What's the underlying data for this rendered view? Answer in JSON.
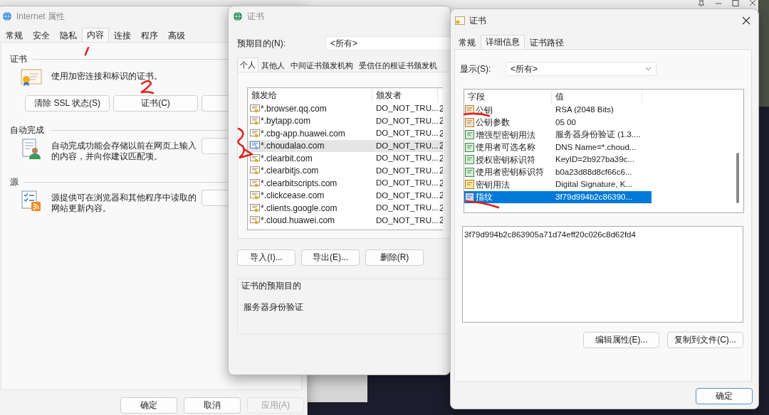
{
  "internet_options": {
    "title": "Internet 属性",
    "tabs": [
      {
        "label": "常规",
        "selected": false
      },
      {
        "label": "安全",
        "selected": false
      },
      {
        "label": "隐私",
        "selected": false
      },
      {
        "label": "内容",
        "selected": true
      },
      {
        "label": "连接",
        "selected": false
      },
      {
        "label": "程序",
        "selected": false
      },
      {
        "label": "高级",
        "selected": false
      }
    ],
    "sections": [
      {
        "kind": "certificates",
        "heading": "证书",
        "description": "使用加密连接和标识的证书。",
        "buttons": [
          "清除 SSL 状态(S)",
          "证书(C)"
        ],
        "covered_button": true
      },
      {
        "kind": "autocomplete",
        "heading": "自动完成",
        "description": "自动完成功能会存储以前在网页上输入的内容，并向你建议匹配项。",
        "covered_button": true
      },
      {
        "kind": "feeds",
        "heading": "源",
        "description": "源提供可在浏览器和其他程序中读取的网站更新内容。",
        "covered_button": true
      }
    ],
    "footer_buttons": [
      {
        "label": "确定",
        "disabled": false
      },
      {
        "label": "取消",
        "disabled": false
      },
      {
        "label": "应用(A)",
        "disabled": true
      }
    ]
  },
  "certificate_manager": {
    "title": "证书",
    "purpose_label": "预期目的(N):",
    "purpose_value": "<所有>",
    "tabs": [
      {
        "label": "个人",
        "selected": true
      },
      {
        "label": "其他人",
        "selected": false
      },
      {
        "label": "中间证书颁发机构",
        "selected": false
      },
      {
        "label": "受信任的根证书颁发机",
        "selected": false
      }
    ],
    "columns": [
      "颁发给",
      "颁发者"
    ],
    "rows": [
      {
        "issued_to": "*.browser.qq.com",
        "issued_by": "DO_NOT_TRU...",
        "column_3": "2",
        "selected": false
      },
      {
        "issued_to": "*.bytapp.com",
        "issued_by": "DO_NOT_TRU...",
        "column_3": "2",
        "selected": false
      },
      {
        "issued_to": "*.cbg-app.huawei.com",
        "issued_by": "DO_NOT_TRU...",
        "column_3": "2",
        "selected": false
      },
      {
        "issued_to": "*.choudalao.com",
        "issued_by": "DO_NOT_TRU...",
        "column_3": "2",
        "selected": true
      },
      {
        "issued_to": "*.clearbit.com",
        "issued_by": "DO_NOT_TRU...",
        "column_3": "2",
        "selected": false
      },
      {
        "issued_to": "*.clearbitjs.com",
        "issued_by": "DO_NOT_TRU...",
        "column_3": "2",
        "selected": false
      },
      {
        "issued_to": "*.clearbitscripts.com",
        "issued_by": "DO_NOT_TRU...",
        "column_3": "2",
        "selected": false
      },
      {
        "issued_to": "*.clickcease.com",
        "issued_by": "DO_NOT_TRU...",
        "column_3": "2",
        "selected": false
      },
      {
        "issued_to": "*.clients.google.com",
        "issued_by": "DO_NOT_TRU...",
        "column_3": "2",
        "selected": false
      },
      {
        "issued_to": "*.cloud.huawei.com",
        "issued_by": "DO_NOT_TRU...",
        "column_3": "2",
        "selected": false
      }
    ],
    "buttons": [
      "导入(I)...",
      "导出(E)...",
      "删除(R)"
    ],
    "purpose_group": {
      "title": "证书的预期目的",
      "text": "服务器身份验证"
    }
  },
  "certificate_viewer": {
    "title": "证书",
    "tabs": [
      {
        "label": "常规",
        "selected": false
      },
      {
        "label": "详细信息",
        "selected": true
      },
      {
        "label": "证书路径",
        "selected": false
      }
    ],
    "show_label": "显示(S):",
    "show_value": "<所有>",
    "columns": [
      "字段",
      "值"
    ],
    "fields": [
      {
        "name": "公钥",
        "value": "RSA (2048 Bits)",
        "kind": "property",
        "selected": false
      },
      {
        "name": "公钥参数",
        "value": "05 00",
        "kind": "property",
        "selected": false
      },
      {
        "name": "增强型密钥用法",
        "value": "服务器身份验证 (1.3....",
        "kind": "extension",
        "selected": false
      },
      {
        "name": "使用者可选名称",
        "value": "DNS Name=*.choud...",
        "kind": "extension",
        "selected": false
      },
      {
        "name": "授权密钥标识符",
        "value": "KeyID=2b927ba39c...",
        "kind": "extension",
        "selected": false
      },
      {
        "name": "使用者密钥标识符",
        "value": "b0a23d88d8cf66c6...",
        "kind": "extension",
        "selected": false
      },
      {
        "name": "密钥用法",
        "value": "Digital Signature, K...",
        "kind": "critical",
        "selected": false
      },
      {
        "name": "指纹",
        "value": "3f79d994b2c86390...",
        "kind": "plain",
        "selected": true
      }
    ],
    "detail": "3f79d994b2c863905a71d74eff20c026c8d62fd4",
    "buttons": [
      "编辑属性(E)...",
      "复制到文件(C)..."
    ],
    "ok_button": "确定"
  }
}
